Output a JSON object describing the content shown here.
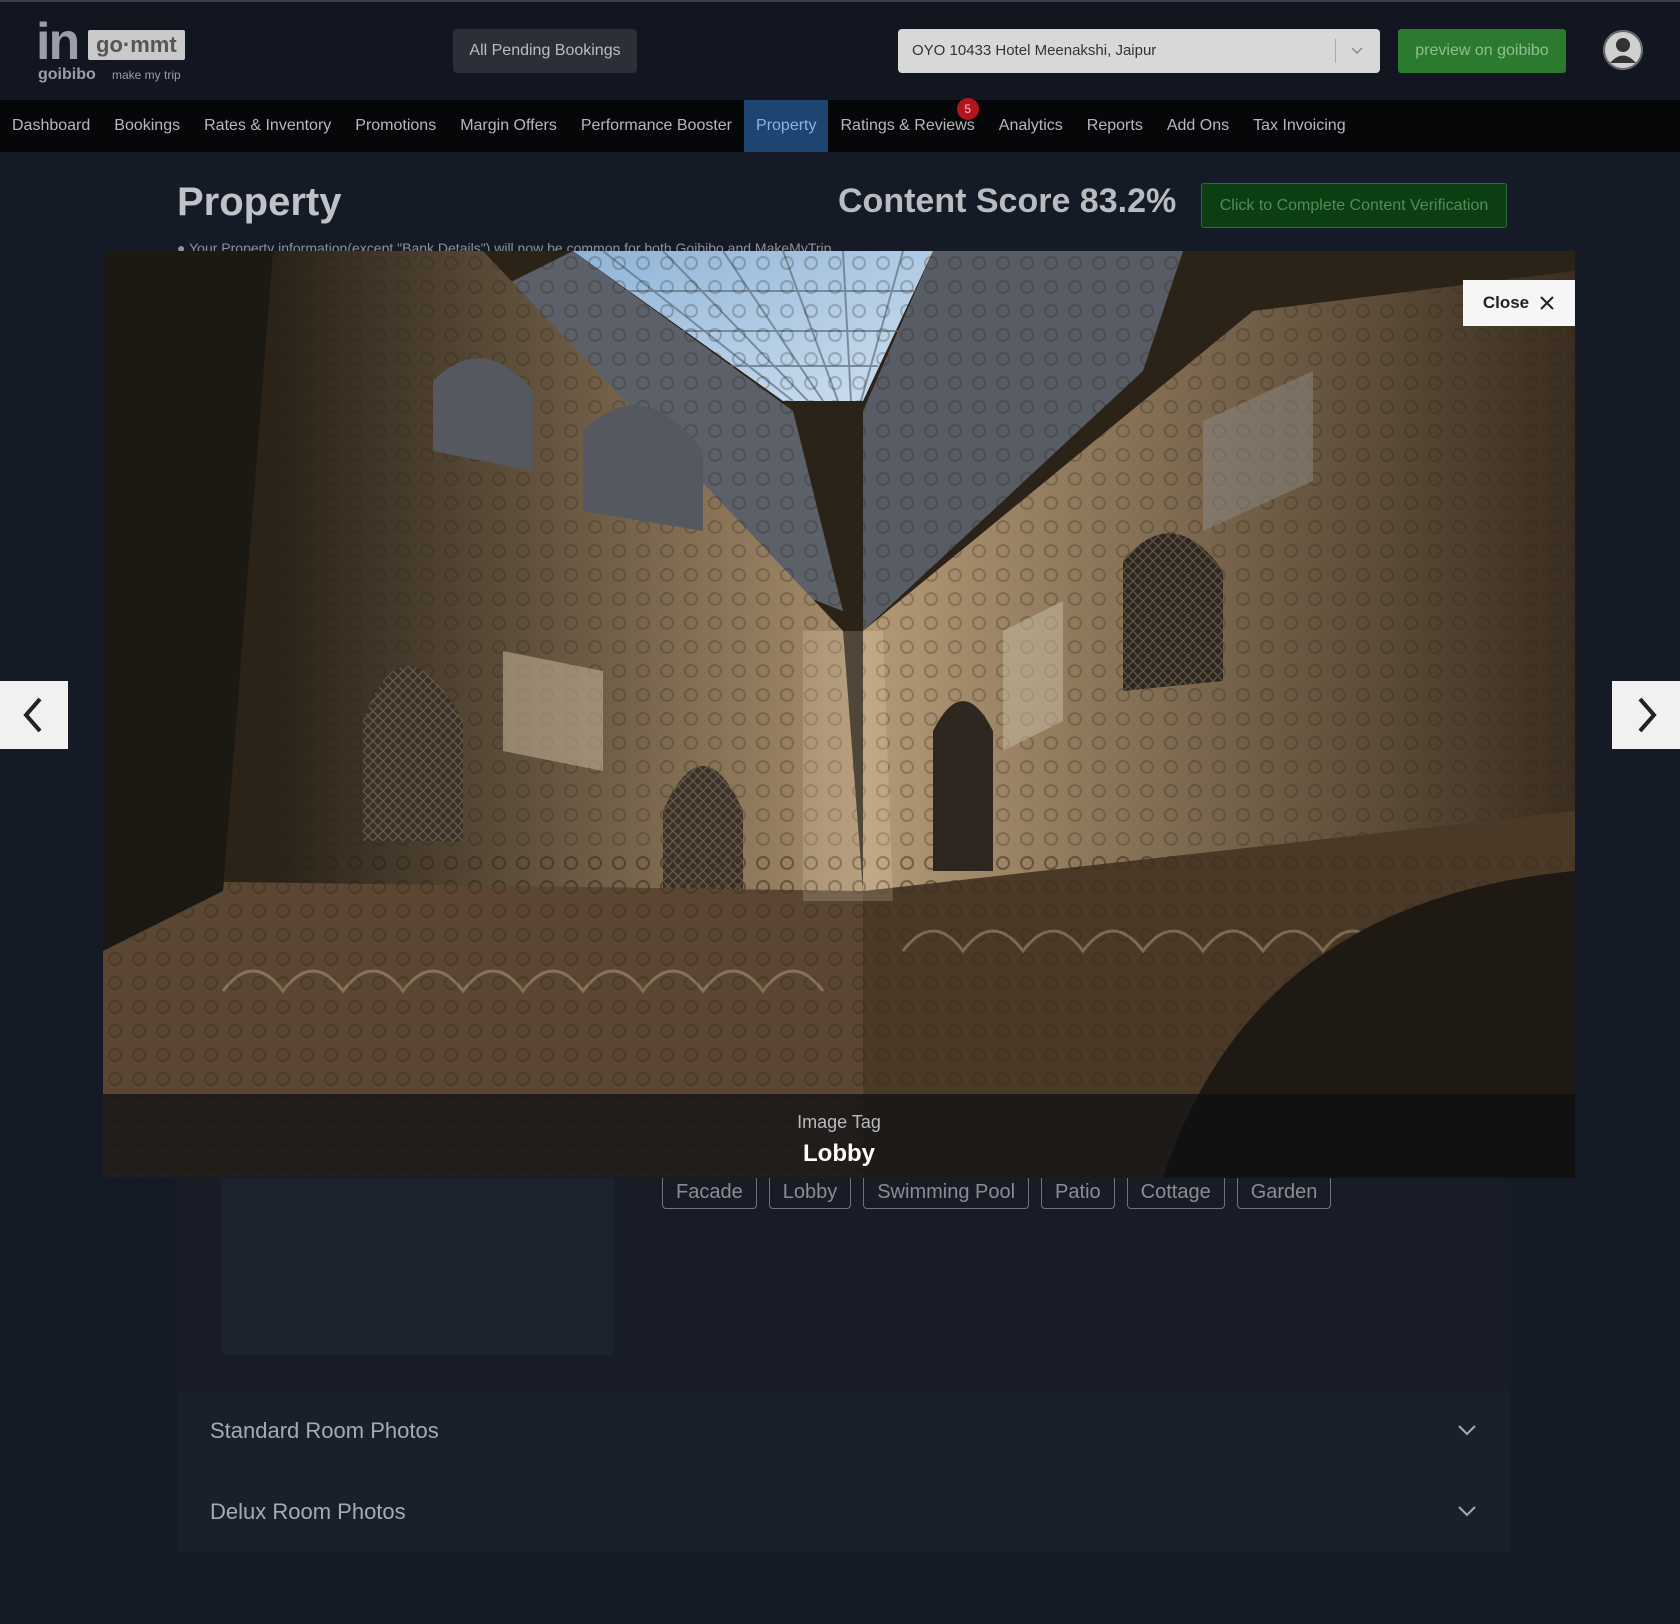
{
  "header": {
    "logo": {
      "in": "in",
      "gommt": "go·mmt",
      "goibibo": "goibibo",
      "makemytrip": "make my trip"
    },
    "pending_bookings": "All Pending Bookings",
    "hotel_select": {
      "value": "OYO 10433 Hotel Meenakshi, Jaipur"
    },
    "preview_button": "preview on goibibo",
    "icons": {
      "chevron": "chevron-down-icon",
      "avatar": "user-avatar-icon"
    }
  },
  "nav": {
    "items": [
      {
        "label": "Dashboard",
        "active": false
      },
      {
        "label": "Bookings",
        "active": false
      },
      {
        "label": "Rates & Inventory",
        "active": false
      },
      {
        "label": "Promotions",
        "active": false
      },
      {
        "label": "Margin Offers",
        "active": false
      },
      {
        "label": "Performance Booster",
        "active": false
      },
      {
        "label": "Property",
        "active": true
      },
      {
        "label": "Ratings & Reviews",
        "active": false,
        "badge": "5"
      },
      {
        "label": "Analytics",
        "active": false
      },
      {
        "label": "Reports",
        "active": false
      },
      {
        "label": "Add Ons",
        "active": false
      },
      {
        "label": "Tax Invoicing",
        "active": false
      }
    ]
  },
  "page": {
    "title": "Property",
    "content_score": "Content Score 83.2%",
    "verify_button": "Click to Complete Content Verification",
    "info_note": "Your Property information(except \"Bank Details\") will now be common for both Goibibo and MakeMyTrip"
  },
  "tags": [
    "Facade",
    "Lobby",
    "Swimming Pool",
    "Patio",
    "Cottage",
    "Garden"
  ],
  "accordions": [
    {
      "label": "Standard Room Photos"
    },
    {
      "label": "Delux Room Photos"
    }
  ],
  "lightbox": {
    "close_label": "Close",
    "caption_label": "Image Tag",
    "caption_value": "Lobby"
  },
  "colors": {
    "accent_nav": "#1e4472",
    "preview_green": "#2c7a2f",
    "badge_red": "#b3141d"
  }
}
